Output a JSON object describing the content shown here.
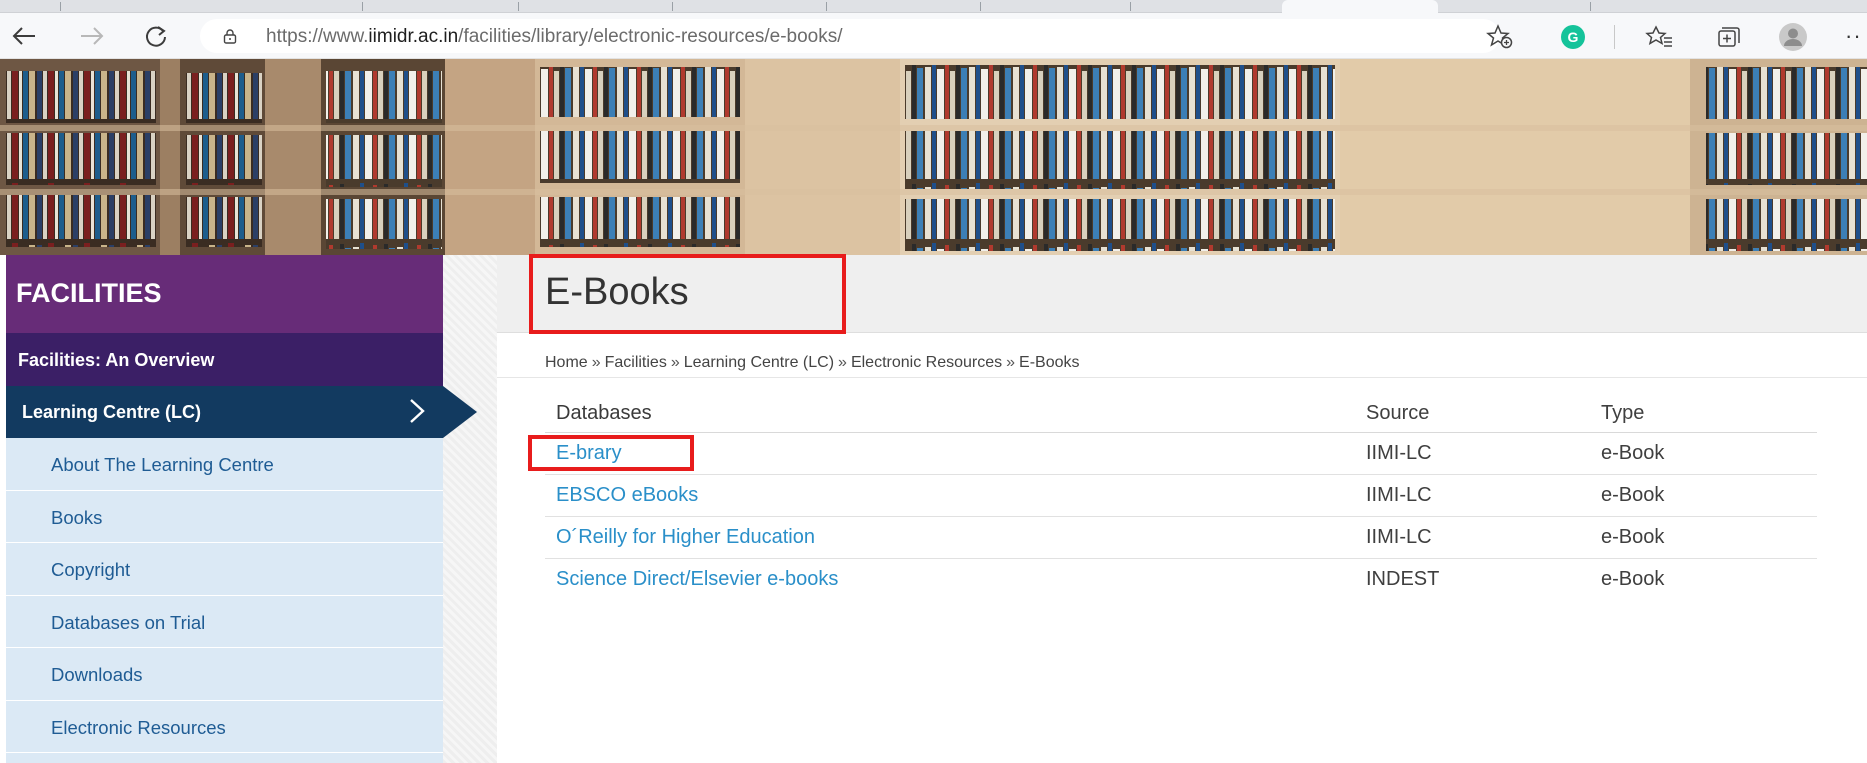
{
  "browser": {
    "url_prefix": "https://www.",
    "url_host": "iimidr.ac.in",
    "url_path": "/facilities/library/electronic-resources/e-books/",
    "back_icon": "back-arrow-icon",
    "forward_icon": "forward-arrow-icon",
    "reload_icon": "reload-icon",
    "more_label": "··"
  },
  "sidebar": {
    "header": "FACILITIES",
    "overview": "Facilities: An Overview",
    "active": "Learning Centre (LC)",
    "items": [
      {
        "label": "About The Learning Centre"
      },
      {
        "label": "Books"
      },
      {
        "label": "Copyright"
      },
      {
        "label": "Databases on Trial"
      },
      {
        "label": "Downloads"
      },
      {
        "label": "Electronic Resources"
      }
    ]
  },
  "content": {
    "title": "E-Books",
    "breadcrumb": {
      "home": "Home",
      "sep": "»",
      "facilities": "Facilities",
      "lc": "Learning Centre (LC)",
      "electronic": "Electronic Resources",
      "current": "E-Books"
    },
    "table": {
      "headers": {
        "databases": "Databases",
        "source": "Source",
        "type": "Type"
      },
      "rows": [
        {
          "name": "E-brary",
          "source": "IIMI-LC",
          "type": "e-Book"
        },
        {
          "name": "EBSCO eBooks",
          "source": "IIMI-LC",
          "type": "e-Book"
        },
        {
          "name": "O´Reilly for Higher Education",
          "source": "IIMI-LC",
          "type": "e-Book"
        },
        {
          "name": "Science Direct/Elsevier e-books",
          "source": "INDEST",
          "type": "e-Book"
        }
      ]
    }
  },
  "colors": {
    "sidebar_header": "#672c78",
    "sidebar_overview": "#3b1f66",
    "sidebar_active": "#123a60",
    "link": "#2a8fc9",
    "highlight": "#e81c1c"
  }
}
